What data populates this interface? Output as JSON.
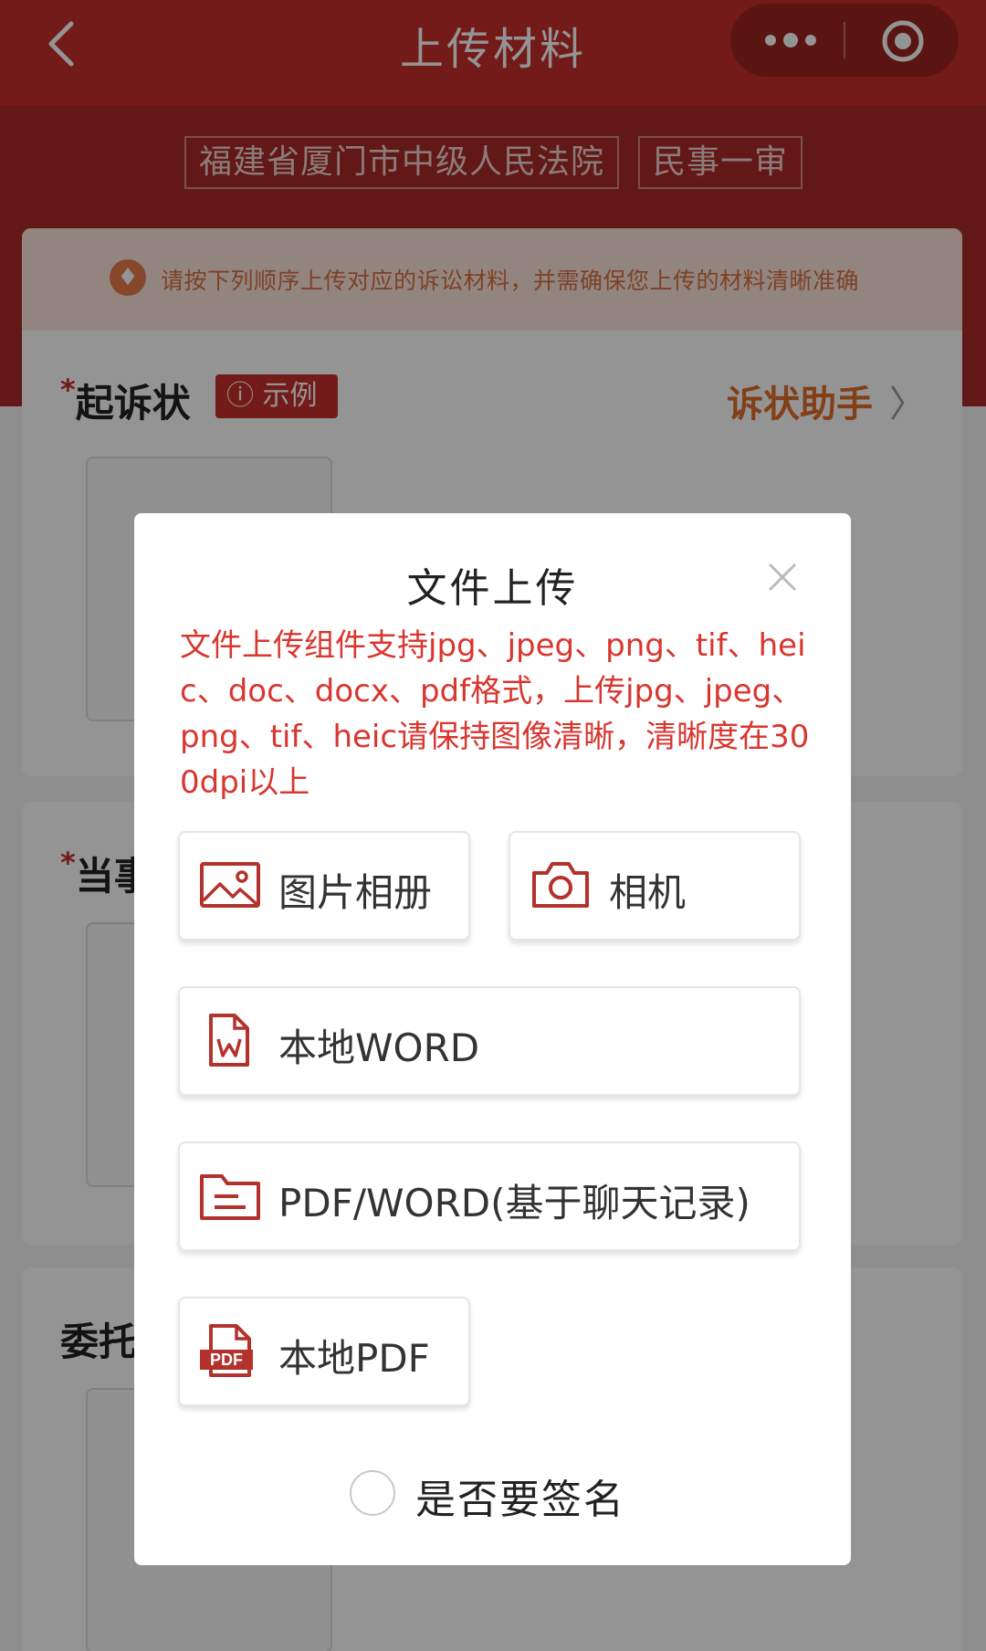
{
  "navbar": {
    "title": "上传材料",
    "back_icon": "chevron-left-icon",
    "more_icon": "more-dots-icon",
    "close_icon": "target-circle-icon"
  },
  "case": {
    "court": "福建省厦门市中级人民法院",
    "type": "民事一审"
  },
  "notice": {
    "icon": "lightbulb-icon",
    "text": "请按下列顺序上传对应的诉讼材料，并需确保您上传的材料清晰准确"
  },
  "fields": [
    {
      "required_mark": "*",
      "label": "起诉状",
      "example": "示例",
      "assistant": "诉状助手",
      "assistant_chevron": "〉"
    },
    {
      "required_mark": "*",
      "label": "当事"
    },
    {
      "required_mark": "",
      "label": "委托"
    }
  ],
  "modal": {
    "title": "文件上传",
    "note": "文件上传组件支持jpg、jpeg、png、tif、heic、doc、docx、pdf格式，上传jpg、jpeg、png、tif、heic请保持图像清晰，清晰度在300dpi以上",
    "options": {
      "album": {
        "label": "图片相册",
        "icon": "image-icon"
      },
      "camera": {
        "label": "相机",
        "icon": "camera-icon"
      },
      "word": {
        "label": "本地WORD",
        "icon": "word-file-icon"
      },
      "chat": {
        "label": "PDF/WORD(基于聊天记录)",
        "icon": "folder-icon"
      },
      "pdf": {
        "label": "本地PDF",
        "icon": "pdf-file-icon",
        "badge": "PDF"
      }
    },
    "sign_label": "是否要签名"
  },
  "colors": {
    "brand_red": "#c62f2b",
    "note_red": "#d9362f",
    "assistant_orange": "#e06d2a"
  }
}
